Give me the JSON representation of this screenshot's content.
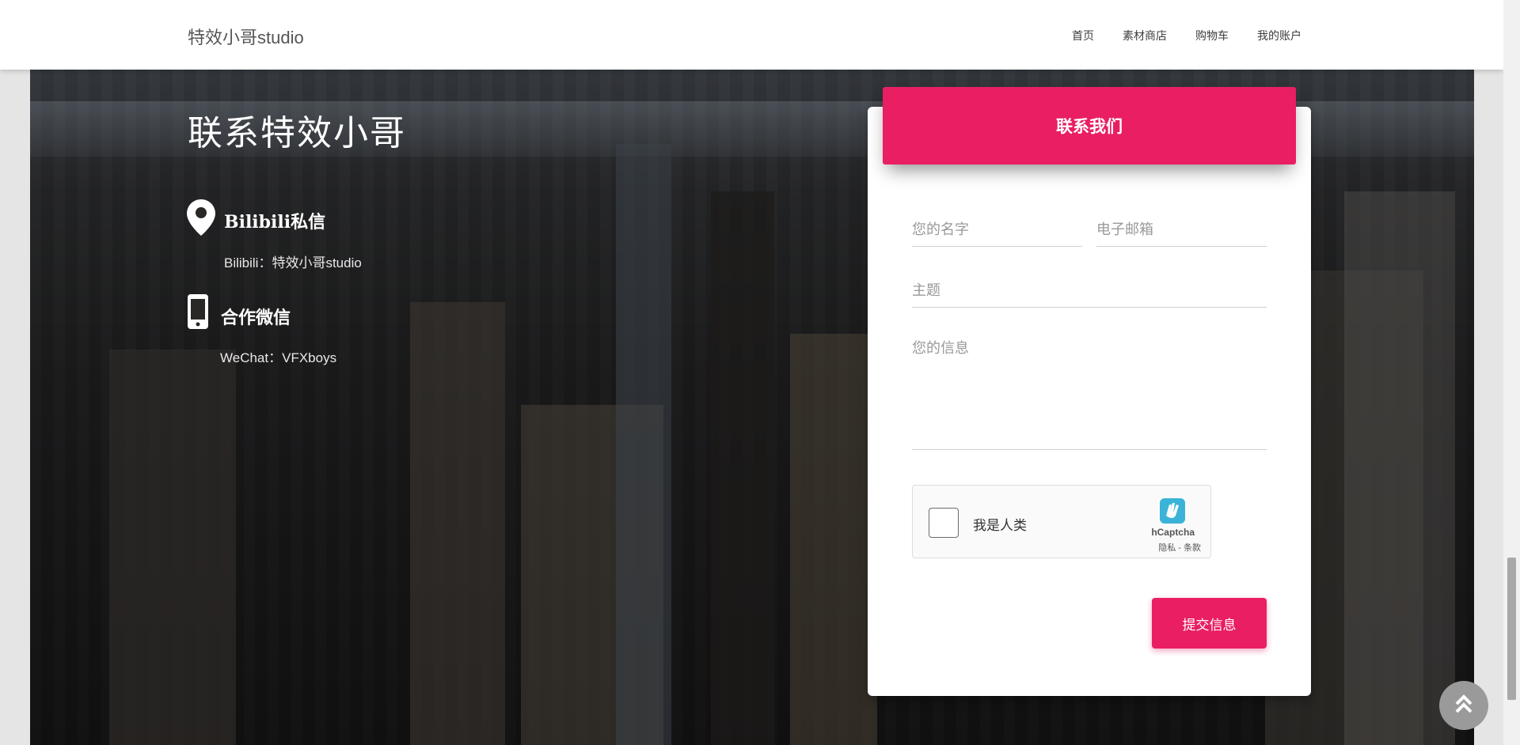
{
  "header": {
    "brand": "特效小哥studio",
    "nav": [
      "首页",
      "素材商店",
      "购物车",
      "我的账户"
    ]
  },
  "contact": {
    "title": "联系特效小哥",
    "items": [
      {
        "icon": "map-pin-icon",
        "heading": "Bilibili私信",
        "text": "Bilibili：特效小哥studio"
      },
      {
        "icon": "mobile-phone-icon",
        "heading": "合作微信",
        "text": "WeChat：VFXboys"
      }
    ]
  },
  "form": {
    "header": "联系我们",
    "name_placeholder": "您的名字",
    "email_placeholder": "电子邮箱",
    "subject_placeholder": "主题",
    "message_placeholder": "您的信息",
    "captcha": {
      "label": "我是人类",
      "brand": "hCaptcha",
      "links": "隐私 - 条款"
    },
    "submit_label": "提交信息"
  },
  "colors": {
    "accent": "#e91e63"
  },
  "icons": {
    "back_to_top": "double-chevron-up-icon"
  }
}
